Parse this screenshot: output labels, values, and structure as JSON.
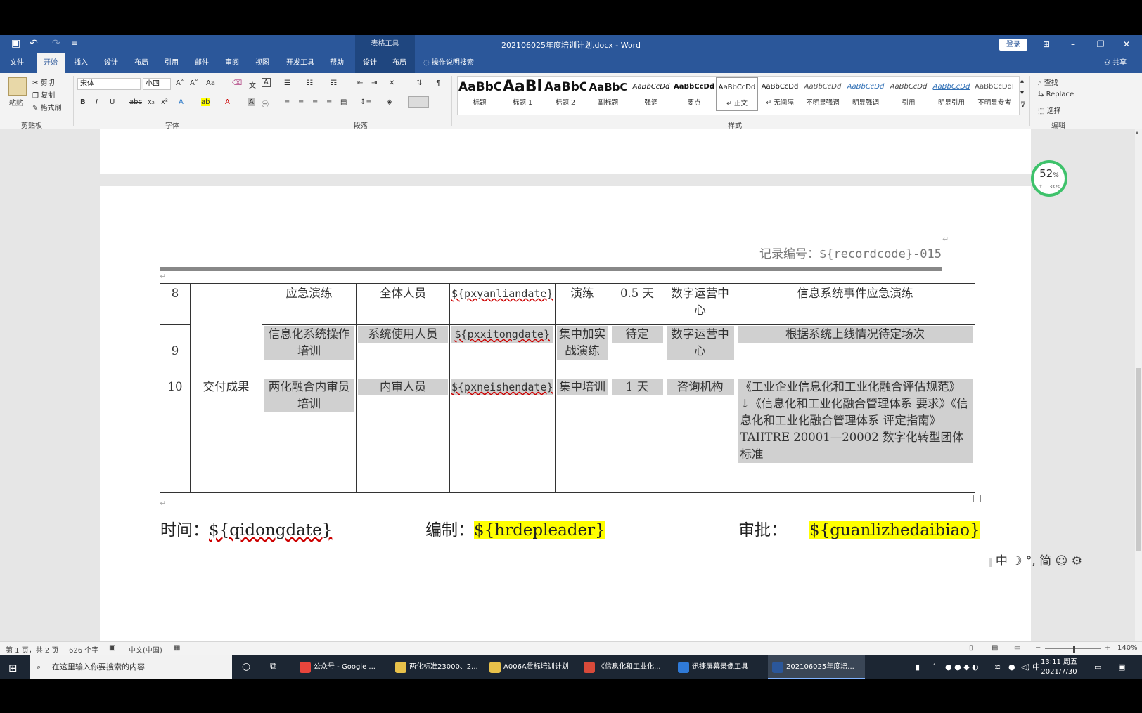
{
  "window": {
    "title": "202106025年度培训计划.docx  -  Word",
    "context_tab_group": "表格工具",
    "login": "登录"
  },
  "tabs": [
    "文件",
    "开始",
    "插入",
    "设计",
    "布局",
    "引用",
    "邮件",
    "审阅",
    "视图",
    "开发工具",
    "帮助",
    "设计",
    "布局"
  ],
  "tell_me": "操作说明搜索",
  "share": "共享",
  "ribbon": {
    "clipboard": {
      "paste": "粘贴",
      "cut": "剪切",
      "copy": "复制",
      "format_painter": "格式刷",
      "label": "剪贴板"
    },
    "font": {
      "name": "宋体",
      "size": "小四",
      "label": "字体"
    },
    "paragraph": {
      "label": "段落"
    },
    "styles": {
      "label": "样式",
      "items": [
        {
          "preview": "AaBbC",
          "name": "标题"
        },
        {
          "preview": "AaBl",
          "name": "标题 1"
        },
        {
          "preview": "AaBbC",
          "name": "标题 2"
        },
        {
          "preview": "AaBbC",
          "name": "副标题"
        },
        {
          "preview": "AaBbCcDd",
          "name": "强调"
        },
        {
          "preview": "AaBbCcDd",
          "name": "要点"
        },
        {
          "preview": "AaBbCcDd",
          "name": "↵ 正文"
        },
        {
          "preview": "AaBbCcDd",
          "name": "↵ 无间隔"
        },
        {
          "preview": "AaBbCcDd",
          "name": "不明显强调"
        },
        {
          "preview": "AaBbCcDd",
          "name": "明显强调"
        },
        {
          "preview": "AaBbCcDd",
          "name": "引用"
        },
        {
          "preview": "AaBbCcDd",
          "name": "明显引用"
        },
        {
          "preview": "AaBbCcDdI",
          "name": "不明显参考"
        }
      ]
    },
    "editing": {
      "find": "查找",
      "replace": "Replace",
      "select": "选择",
      "label": "编辑"
    }
  },
  "document": {
    "record_code": "记录编号：${recordcode}-015",
    "rows": [
      {
        "no": "8",
        "category": "",
        "course": "应急演练",
        "audience": "全体人员",
        "date": "${pxyanliandate}",
        "method": "演练",
        "duration": "0.5 天",
        "org": "数字运营中心",
        "content": "信息系统事件应急演练"
      },
      {
        "no": "9",
        "category": "",
        "course": "信息化系统操作培训",
        "audience": "系统使用人员",
        "date": "${pxxitongdate}",
        "method": "集中加实战演练",
        "duration": "待定",
        "org": "数字运营中心",
        "content": "根据系统上线情况待定场次"
      },
      {
        "no": "10",
        "category": "交付成果",
        "course": "两化融合内审员培训",
        "audience": "内审人员",
        "date": "${pxneishendate}",
        "method": "集中培训",
        "duration": "1 天",
        "org": "咨询机构",
        "content": "《工业企业信息化和工业化融合评估规范》↓《信息化和工业化融合管理体系  要求》《信息化和工业化融合管理体系  评定指南》TAIITRE 20001—20002 数字化转型团体标准"
      }
    ],
    "signature": {
      "time_label": "时间：",
      "time_value": "${qidongdate}",
      "author_label": "编制：",
      "author_value": "${hrdepleader}",
      "approve_label": "审批：",
      "approve_value": "${guanlizhedaibiao}"
    }
  },
  "progress_widget": {
    "percent": "52",
    "unit": "%",
    "speed": "↑ 1.3K/s"
  },
  "ime_bar": "中 ☽ °, 简 ☺ ⚙",
  "statusbar": {
    "page": "第 1 页，共 2 页",
    "words": "626 个字",
    "language": "中文(中国)",
    "zoom": "140%"
  },
  "taskbar": {
    "search_placeholder": "在这里输入你要搜索的内容",
    "tasks": [
      "公众号 - Google ...",
      "两化标准23000、2...",
      "A006A贯标培训计划",
      "《信息化和工业化...",
      "迅捷屏幕录像工具",
      "202106025年度培..."
    ],
    "ime": "中",
    "time": "13:11 周五",
    "date": "2021/7/30"
  },
  "colors": {
    "word_blue": "#2b579a",
    "highlight": "#ffff00",
    "shading": "#d0d0d0"
  }
}
